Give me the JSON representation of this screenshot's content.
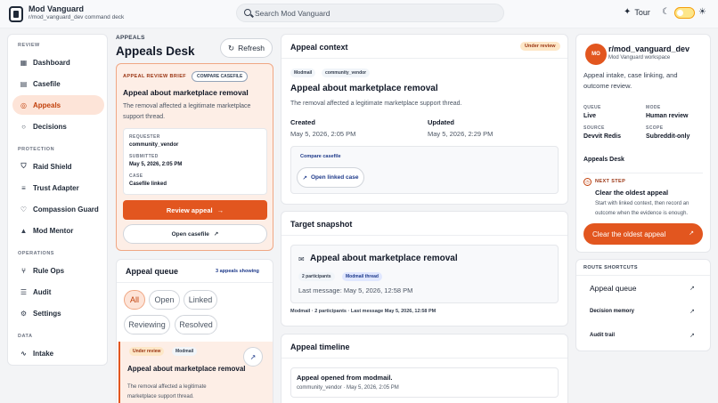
{
  "app": {
    "title": "Mod Vanguard",
    "subtitle": "r/mod_vanguard_dev command deck"
  },
  "search": {
    "placeholder": "Search Mod Vanguard"
  },
  "topbar": {
    "tour_label": "Tour"
  },
  "sidebar": {
    "sections": [
      {
        "label": "REVIEW",
        "items": [
          "Dashboard",
          "Casefile",
          "Appeals",
          "Decisions"
        ]
      },
      {
        "label": "PROTECTION",
        "items": [
          "Raid Shield",
          "Trust Adapter",
          "Compassion Guard",
          "Mod Mentor"
        ]
      },
      {
        "label": "OPERATIONS",
        "items": [
          "Rule Ops",
          "Audit",
          "Settings"
        ]
      },
      {
        "label": "DATA",
        "items": [
          "Intake"
        ]
      }
    ],
    "active": "Appeals"
  },
  "page": {
    "breadcrumb": "APPEALS",
    "title": "Appeals Desk",
    "refresh_label": "Refresh"
  },
  "brief": {
    "label": "APPEAL REVIEW BRIEF",
    "compare_label": "COMPARE CASEFILE",
    "title": "Appeal about marketplace removal",
    "description": "The removal affected a legitimate marketplace support thread.",
    "requester_key": "REQUESTER",
    "requester": "community_vendor",
    "submitted_key": "SUBMITTED",
    "submitted": "May 5, 2026, 2:05 PM",
    "case_key": "CASE",
    "case": "Casefile linked",
    "review_button": "Review appeal",
    "open_casefile": "Open casefile"
  },
  "queue": {
    "title": "Appeal queue",
    "count": "3 appeals showing",
    "filters": [
      "All",
      "Open",
      "Linked",
      "Reviewing",
      "Resolved"
    ],
    "active_filter": "All",
    "items": [
      {
        "status": "Under review",
        "source": "Modmail",
        "title": "Appeal about marketplace removal",
        "description": "The removal affected a legitimate marketplace support thread."
      }
    ]
  },
  "context": {
    "title": "Appeal context",
    "badge": "Under review",
    "tags": [
      "Modmail",
      "community_vendor"
    ],
    "heading": "Appeal about marketplace removal",
    "description": "The removal affected a legitimate marketplace support thread.",
    "created_label": "Created",
    "created": "May 5, 2026, 2:05 PM",
    "updated_label": "Updated",
    "updated": "May 5, 2026, 2:29 PM",
    "compare_label": "Compare casefile",
    "open_linked": "Open linked case"
  },
  "snapshot": {
    "title": "Target snapshot",
    "heading": "Appeal about marketplace removal",
    "tags": [
      "2 participants",
      "Modmail thread"
    ],
    "last_message": "Last message: May 5, 2026, 12:58 PM",
    "footer": "Modmail · 2 participants · Last message May 5, 2026, 12:58 PM"
  },
  "timeline": {
    "title": "Appeal timeline",
    "events": [
      {
        "title": "Appeal opened from modmail.",
        "meta": "community_vendor · May 5, 2026, 2:05 PM"
      }
    ]
  },
  "workspace": {
    "avatar": "MO",
    "name": "r/mod_vanguard_dev",
    "subtitle": "Mod Vanguard workspace",
    "description": "Appeal intake, case linking, and outcome review.",
    "queue_key": "QUEUE",
    "queue": "Live",
    "mode_key": "MODE",
    "mode": "Human review",
    "source_key": "SOURCE",
    "source": "Devvit Redis",
    "scope_key": "SCOPE",
    "scope": "Subreddit-only",
    "desk": "Appeals Desk",
    "next_step_label": "NEXT STEP",
    "next_step_title": "Clear the oldest appeal",
    "next_step_desc": "Start with linked context, then record an outcome when the evidence is enough.",
    "cta": "Clear the oldest appeal"
  },
  "shortcuts": {
    "label": "ROUTE SHORTCUTS",
    "items": [
      "Appeal queue",
      "Decision memory",
      "Audit trail"
    ]
  },
  "colors": {
    "accent": "#e2561f",
    "accent_soft": "#fde4d8",
    "link": "#1e3a8a"
  }
}
